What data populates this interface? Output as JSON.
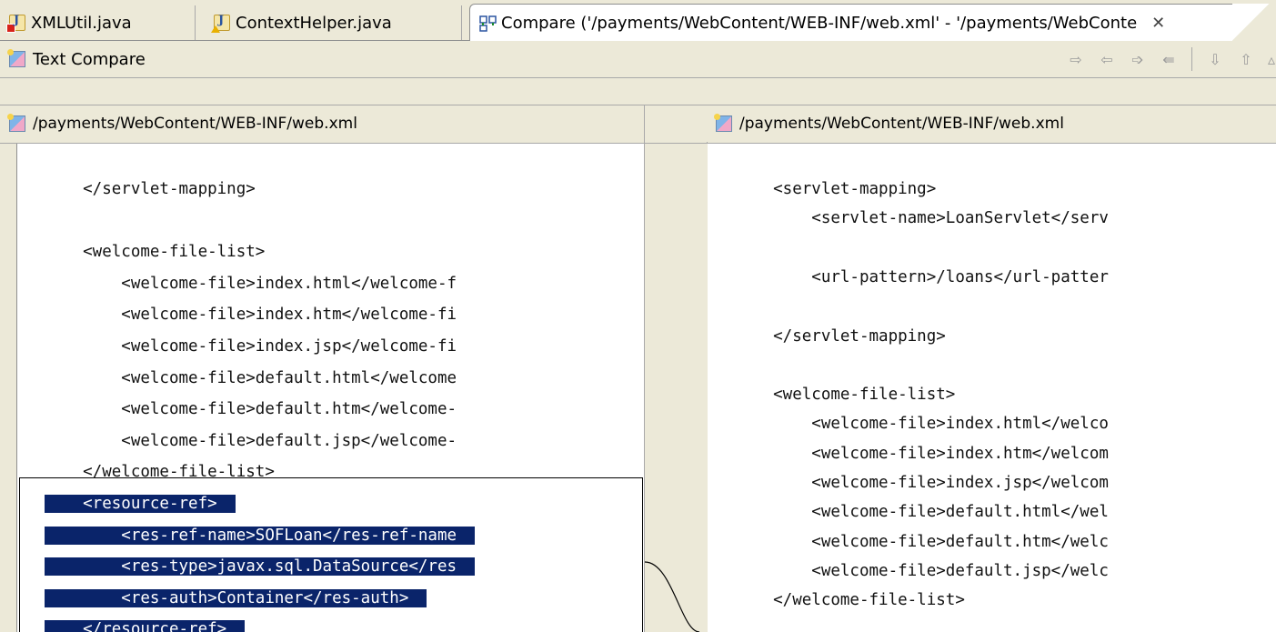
{
  "tabs": [
    {
      "label": "XMLUtil.java",
      "icon": "java-file-error-icon"
    },
    {
      "label": "ContextHelper.java",
      "icon": "java-file-warning-icon"
    },
    {
      "label": "Compare ('/payments/WebContent/WEB-INF/web.xml' - '/payments/WebConte",
      "icon": "compare-icon",
      "active": true
    }
  ],
  "compare": {
    "title": "Text Compare"
  },
  "left_pane": {
    "path": "/payments/WebContent/WEB-INF/web.xml",
    "lines": [
      {
        "text": "    </servlet-mapping>",
        "selected": false
      },
      {
        "text": "",
        "selected": false
      },
      {
        "text": "    <welcome-file-list>",
        "selected": false
      },
      {
        "text": "        <welcome-file>index.html</welcome-f",
        "selected": false
      },
      {
        "text": "        <welcome-file>index.htm</welcome-fi",
        "selected": false
      },
      {
        "text": "        <welcome-file>index.jsp</welcome-fi",
        "selected": false
      },
      {
        "text": "        <welcome-file>default.html</welcome",
        "selected": false
      },
      {
        "text": "        <welcome-file>default.htm</welcome-",
        "selected": false
      },
      {
        "text": "        <welcome-file>default.jsp</welcome-",
        "selected": false
      },
      {
        "text": "    </welcome-file-list>",
        "selected": false
      },
      {
        "text": "    <resource-ref>",
        "selected": true
      },
      {
        "text": "        <res-ref-name>SOFLoan</res-ref-name",
        "selected": true
      },
      {
        "text": "        <res-type>javax.sql.DataSource</res",
        "selected": true
      },
      {
        "text": "        <res-auth>Container</res-auth>",
        "selected": true
      },
      {
        "text": "    </resource-ref>",
        "selected": true
      }
    ]
  },
  "right_pane": {
    "path": "/payments/WebContent/WEB-INF/web.xml",
    "lines": [
      "    <servlet-mapping>",
      "        <servlet-name>LoanServlet</serv",
      "",
      "        <url-pattern>/loans</url-patter",
      "",
      "    </servlet-mapping>",
      "",
      "    <welcome-file-list>",
      "        <welcome-file>index.html</welco",
      "        <welcome-file>index.htm</welcom",
      "        <welcome-file>index.jsp</welcom",
      "        <welcome-file>default.html</wel",
      "        <welcome-file>default.htm</welc",
      "        <welcome-file>default.jsp</welc",
      "    </welcome-file-list>"
    ]
  },
  "colors": {
    "selection": "#0a246a",
    "chrome": "#ece9d8"
  }
}
